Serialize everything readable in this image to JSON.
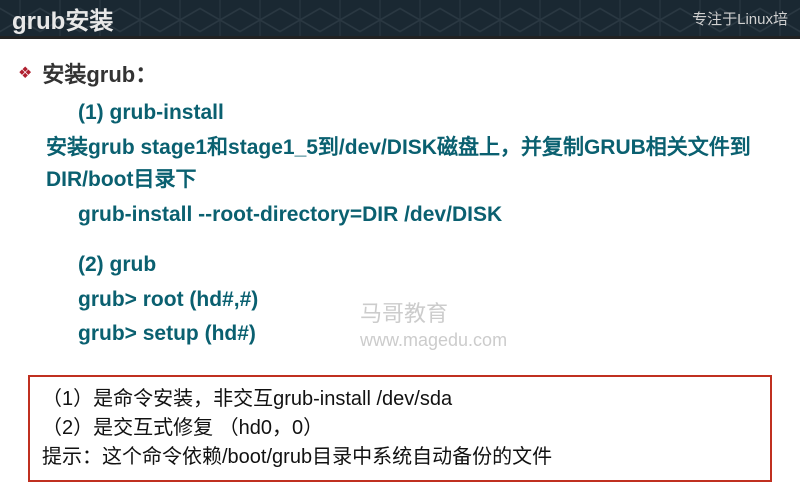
{
  "header": {
    "title": "grub安装",
    "right": "专注于Linux培"
  },
  "section": {
    "bullet_zh": "安装",
    "bullet_en": "grub",
    "bullet_colon": "："
  },
  "lines": {
    "l1": "(1) grub-install",
    "l2": "安装grub stage1和stage1_5到/dev/DISK磁盘上，并复制GRUB相关文件到 DIR/boot目录下",
    "l3": "grub-install --root-directory=DIR /dev/DISK",
    "l4": "(2) grub",
    "l5": "grub> root (hd#,#)",
    "l6": "grub> setup (hd#)"
  },
  "watermark": {
    "w1": "马哥教育",
    "w2": "www.magedu.com"
  },
  "note": {
    "n1": "（1）是命令安装，非交互grub-install /dev/sda",
    "n2": "（2）是交互式修复 （hd0，0）",
    "n3": "提示：这个命令依赖/boot/grub目录中系统自动备份的文件"
  }
}
